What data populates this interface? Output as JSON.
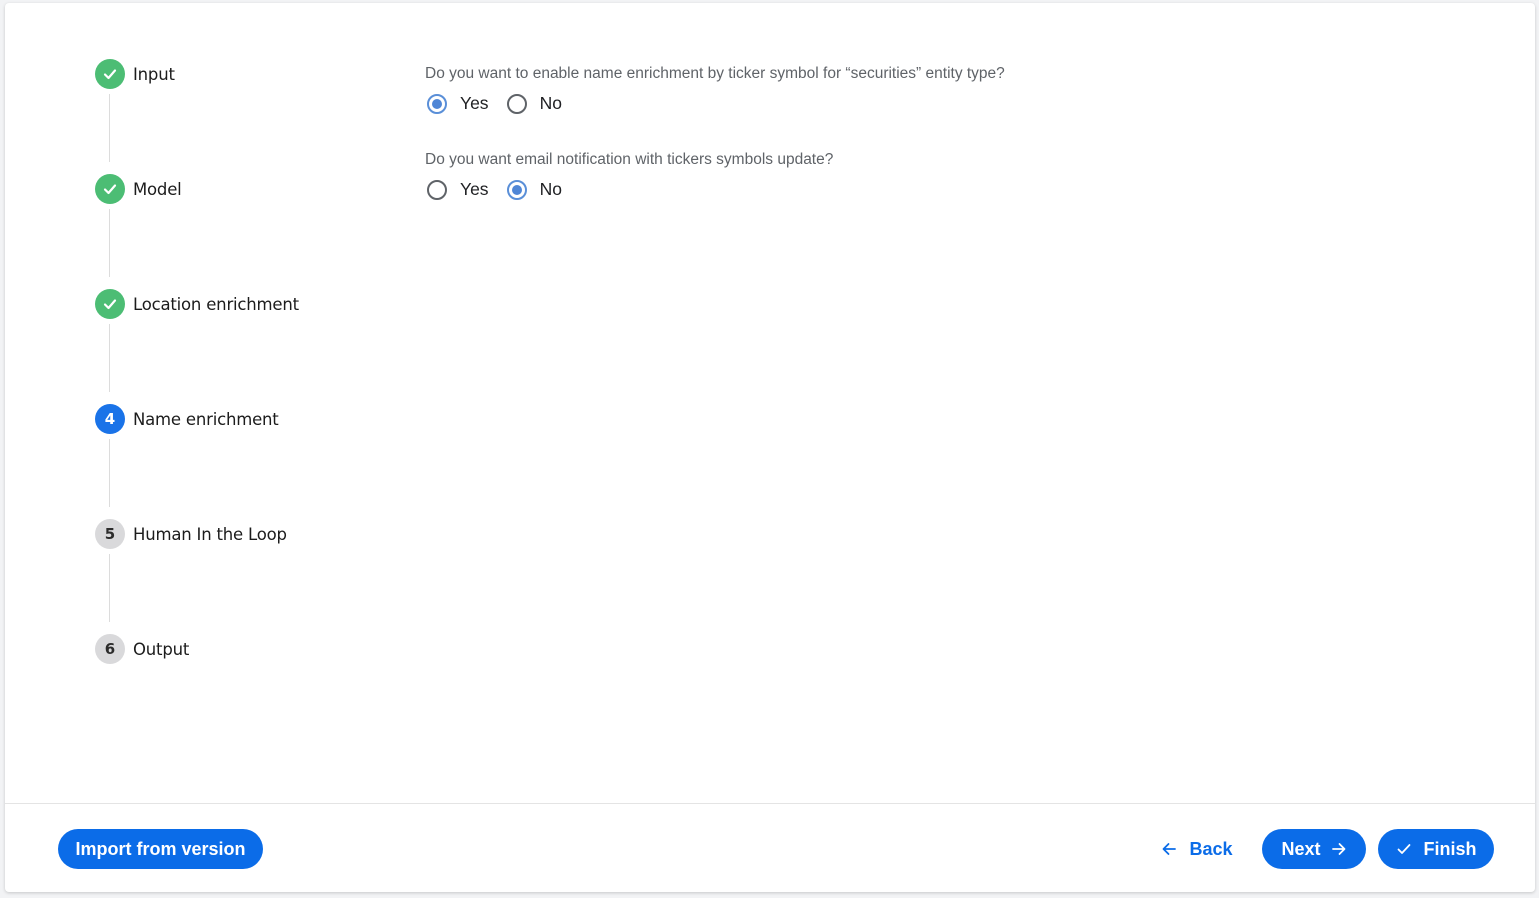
{
  "stepper": {
    "steps": [
      {
        "label": "Input",
        "status": "done",
        "marker": ""
      },
      {
        "label": "Model",
        "status": "done",
        "marker": ""
      },
      {
        "label": "Location enrichment",
        "status": "done",
        "marker": ""
      },
      {
        "label": "Name enrichment",
        "status": "active",
        "marker": "4"
      },
      {
        "label": "Human In the Loop",
        "status": "pending",
        "marker": "5"
      },
      {
        "label": "Output",
        "status": "pending",
        "marker": "6"
      }
    ]
  },
  "questions": [
    {
      "text": "Do you want to enable name enrichment by ticker symbol for “securities” entity type?",
      "options": [
        "Yes",
        "No"
      ],
      "selected": "Yes"
    },
    {
      "text": "Do you want email notification with tickers symbols update?",
      "options": [
        "Yes",
        "No"
      ],
      "selected": "No"
    }
  ],
  "footer": {
    "import_label": "Import from version",
    "back_label": "Back",
    "next_label": "Next",
    "finish_label": "Finish"
  },
  "colors": {
    "primary": "#0b6ce8",
    "done": "#4cbd74",
    "active_step": "#1a73e8",
    "pending_step": "#d9d9db",
    "radio_checked": "#4f86d6"
  }
}
